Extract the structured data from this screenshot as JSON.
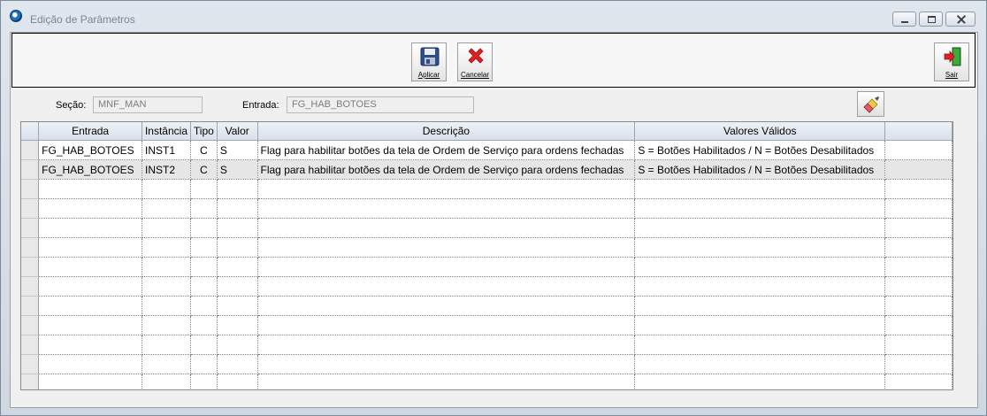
{
  "window": {
    "title": "Edição de Parâmetros"
  },
  "toolbar": {
    "apply_label": "Aplicar",
    "cancel_label": "Cancelar",
    "exit_label": "Sair"
  },
  "filters": {
    "section_label": "Seção:",
    "section_value": "MNF_MAN",
    "entry_label": "Entrada:",
    "entry_value": "FG_HAB_BOTOES"
  },
  "grid": {
    "columns": [
      "Entrada",
      "Instância",
      "Tipo",
      "Valor",
      "Descrição",
      "Valores Válidos"
    ],
    "rows": [
      {
        "entrada": "FG_HAB_BOTOES",
        "instancia": "INST1",
        "tipo": "C",
        "valor": "S",
        "descricao": "Flag para habilitar botões da tela de Ordem de Serviço para ordens fechadas",
        "validos": "S = Botões Habilitados / N = Botões Desabilitados"
      },
      {
        "entrada": "FG_HAB_BOTOES",
        "instancia": "INST2",
        "tipo": "C",
        "valor": "S",
        "descricao": "Flag para habilitar botões da tela de Ordem de Serviço para ordens fechadas",
        "validos": "S = Botões Habilitados / N = Botões Desabilitados"
      }
    ]
  },
  "colors": {
    "titlebar": "#dfe6ee",
    "header": "#d9e1ec",
    "cancel_red": "#e02020",
    "exit_green": "#2e8b2e"
  }
}
